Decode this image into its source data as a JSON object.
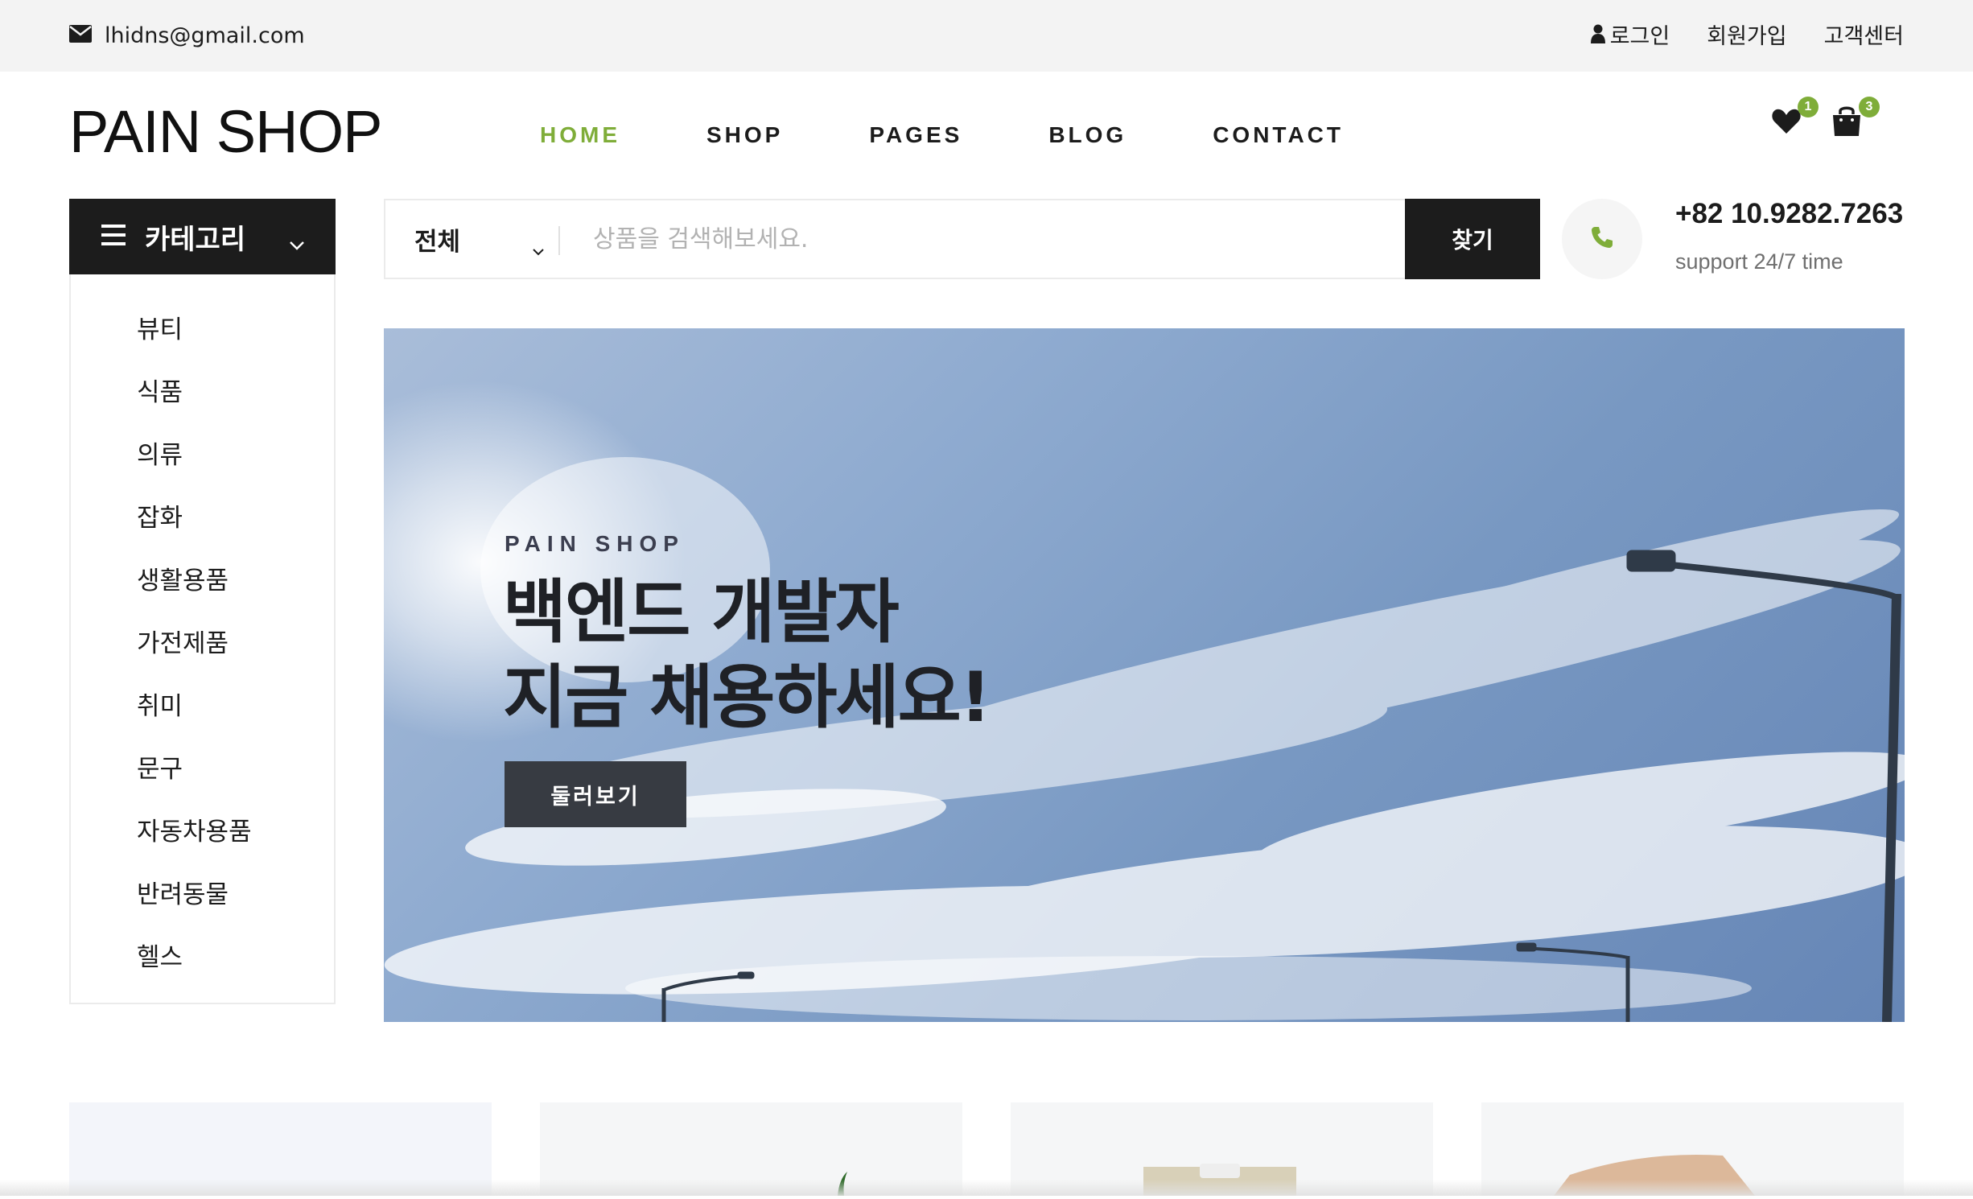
{
  "topbar": {
    "email": "lhidns@gmail.com",
    "links": [
      "로그인",
      "회원가입",
      "고객센터"
    ]
  },
  "header": {
    "logo": "PAIN SHOP",
    "nav": [
      "HOME",
      "SHOP",
      "PAGES",
      "BLOG",
      "CONTACT"
    ],
    "active_nav": "HOME",
    "wishlist_count": "1",
    "cart_count": "3"
  },
  "categories": {
    "title": "카테고리",
    "items": [
      "뷰티",
      "식품",
      "의류",
      "잡화",
      "생활용품",
      "가전제품",
      "취미",
      "문구",
      "자동차용품",
      "반려동물",
      "헬스"
    ]
  },
  "search": {
    "selected_category": "전체",
    "placeholder": "상품을 검색해보세요.",
    "button": "찾기"
  },
  "support": {
    "phone": "+82 10.9282.7263",
    "label": "support 24/7 time"
  },
  "hero": {
    "eyebrow": "PAIN SHOP",
    "line1": "백엔드 개발자",
    "line2": "지금 채용하세요!",
    "cta": "둘러보기"
  },
  "colors": {
    "accent": "#7fad39",
    "dark": "#1c1c1c",
    "topbar": "#f3f3f3"
  }
}
